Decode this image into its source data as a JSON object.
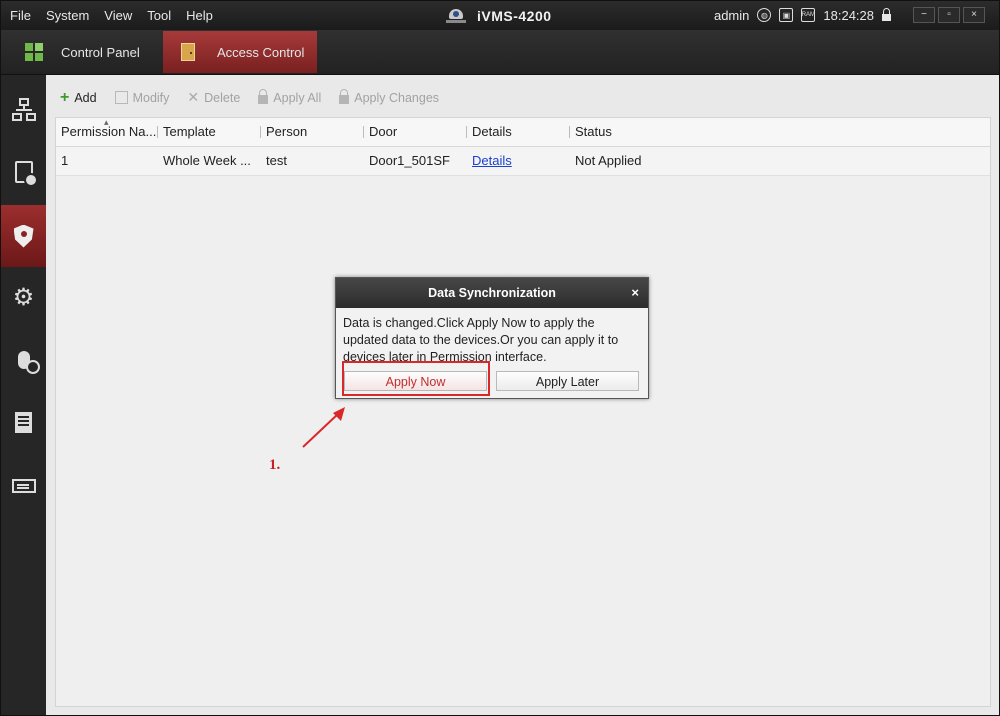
{
  "menubar": {
    "menus": [
      "File",
      "System",
      "View",
      "Tool",
      "Help"
    ],
    "app_title": "iVMS-4200",
    "user": "admin",
    "ram_label": "RAM",
    "time": "18:24:28",
    "window_buttons": [
      "−",
      "▫",
      "×"
    ]
  },
  "tabs": {
    "control_panel": "Control Panel",
    "access_control": "Access Control"
  },
  "sidebar": {
    "items": [
      "device-management",
      "attendance",
      "access-control",
      "configuration",
      "intercom",
      "log-search",
      "device-display"
    ],
    "active": "access-control"
  },
  "toolbar": {
    "add": "Add",
    "modify": "Modify",
    "delete": "Delete",
    "apply_all": "Apply All",
    "apply_changes": "Apply Changes"
  },
  "table": {
    "columns": [
      "Permission Na...",
      "Template",
      "Person",
      "Door",
      "Details",
      "Status"
    ],
    "rows": [
      {
        "permission": "1",
        "template": "Whole Week ...",
        "person": "test",
        "door": "Door1_501SF",
        "details": "Details",
        "status": "Not Applied"
      }
    ]
  },
  "dialog": {
    "title": "Data Synchronization",
    "close": "×",
    "message": "Data is changed.Click Apply Now to apply the updated data to the devices.Or you can apply it to devices later in Permission interface.",
    "apply_now": "Apply Now",
    "apply_later": "Apply Later"
  },
  "annotation": {
    "step": "1.",
    "color": "#d9272a"
  },
  "colors": {
    "accent_red": "#8f2626",
    "link": "#1a3fd1",
    "add_green": "#3d9b2c"
  }
}
